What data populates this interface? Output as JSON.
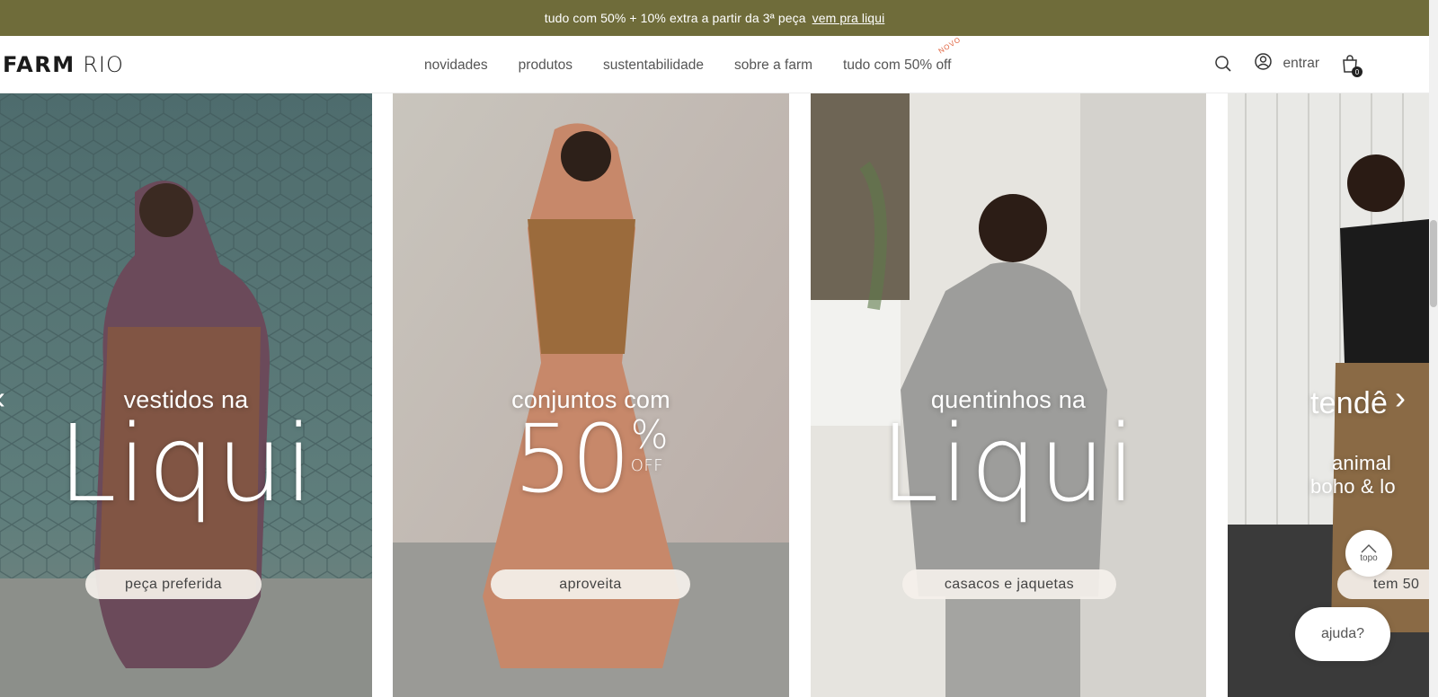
{
  "promo": {
    "text": "tudo com 50% + 10% extra a partir da 3ª peça",
    "link": "vem pra liqui"
  },
  "header": {
    "logo_bold": "FARM",
    "logo_light": "RIO",
    "nav": [
      "novidades",
      "produtos",
      "sustentabilidade",
      "sobre a farm",
      "tudo com 50% off"
    ],
    "nav_badge": "NOVO",
    "login_label": "entrar",
    "cart_count": "0"
  },
  "slides": [
    {
      "small": "vestidos na",
      "big": "Liqui",
      "button": "peça preferida"
    },
    {
      "small": "conjuntos com",
      "big_number": "50",
      "big_sign": "%",
      "big_suffix": "OFF",
      "button": "aproveita"
    },
    {
      "small": "quentinhos na",
      "big": "Liqui",
      "button": "casacos e jaquetas"
    },
    {
      "small": "tendê",
      "line1": "animal",
      "line2": "boho & lo",
      "button": "tem 50"
    }
  ],
  "floating": {
    "top_label": "topo",
    "help_label": "ajuda?"
  },
  "colors": {
    "promo_bg": "#6f6c3a",
    "pill_bg": "#f4f0eb",
    "novo_badge": "#e0603b"
  }
}
